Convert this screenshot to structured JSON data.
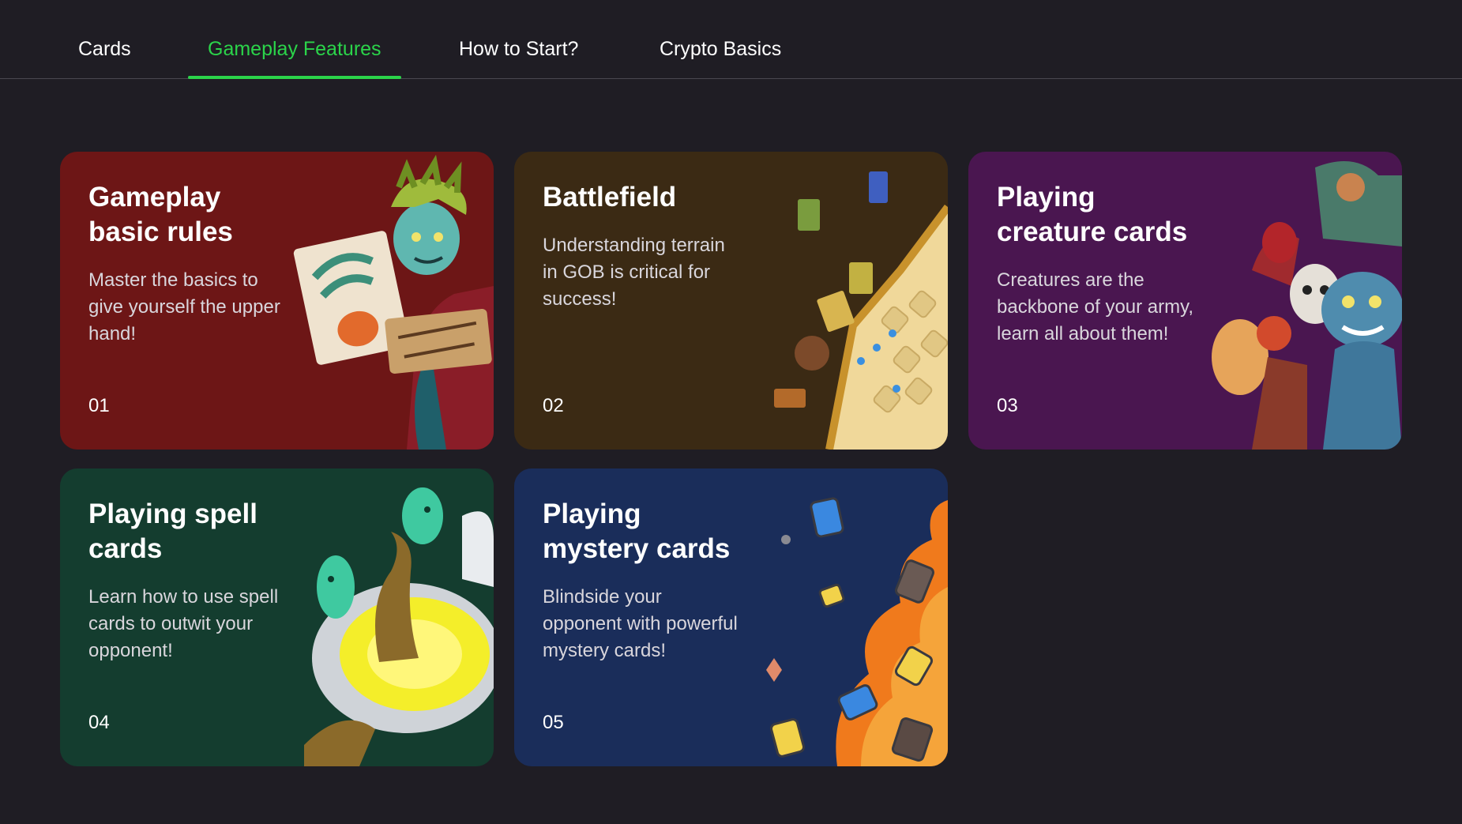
{
  "tabs": [
    {
      "label": "Cards",
      "active": false
    },
    {
      "label": "Gameplay Features",
      "active": true
    },
    {
      "label": "How to Start?",
      "active": false
    },
    {
      "label": "Crypto Basics",
      "active": false
    }
  ],
  "colors": {
    "background": "#1f1d24",
    "accent": "#2bd44a"
  },
  "cards": [
    {
      "title": "Gameplay\nbasic rules",
      "description": "Master the basics to give yourself the upper hand!",
      "number": "01",
      "color": "#6d1616",
      "art": "wraith-writer-illustration"
    },
    {
      "title": "Battlefield",
      "description": "Understanding terrain in GOB is critical for success!",
      "number": "02",
      "color": "#3b2a14",
      "art": "battlefield-board-illustration"
    },
    {
      "title": "Playing\ncreature cards",
      "description": "Creatures are the backbone of your army, learn all about them!",
      "number": "03",
      "color": "#4a1650",
      "art": "creatures-group-illustration"
    },
    {
      "title": "Playing spell\ncards",
      "description": "Learn how to use spell cards to outwit your opponent!",
      "number": "04",
      "color": "#143d2f",
      "art": "spell-toilet-illustration"
    },
    {
      "title": "Playing\nmystery cards",
      "description": "Blindside your opponent with powerful mystery cards!",
      "number": "05",
      "color": "#1a2d5a",
      "art": "mystery-flames-illustration"
    }
  ]
}
